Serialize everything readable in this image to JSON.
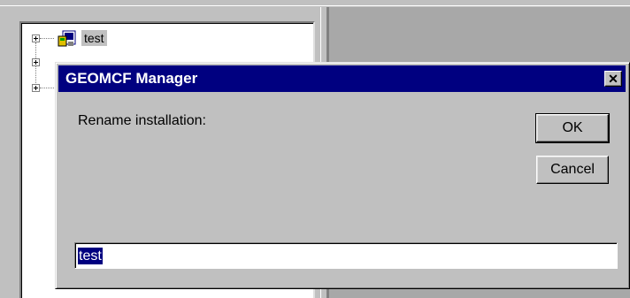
{
  "tree": {
    "items": [
      {
        "label": "test",
        "icon": "installation-icon",
        "selected": true
      }
    ]
  },
  "dialog": {
    "title": "GEOMCF Manager",
    "close_glyph": "✕",
    "prompt": "Rename installation:",
    "ok_label": "OK",
    "cancel_label": "Cancel",
    "name_value": "test"
  },
  "colors": {
    "title_bar": "#000080",
    "face": "#c0c0c0",
    "selection": "#000080",
    "workspace": "#a8a8a8"
  }
}
